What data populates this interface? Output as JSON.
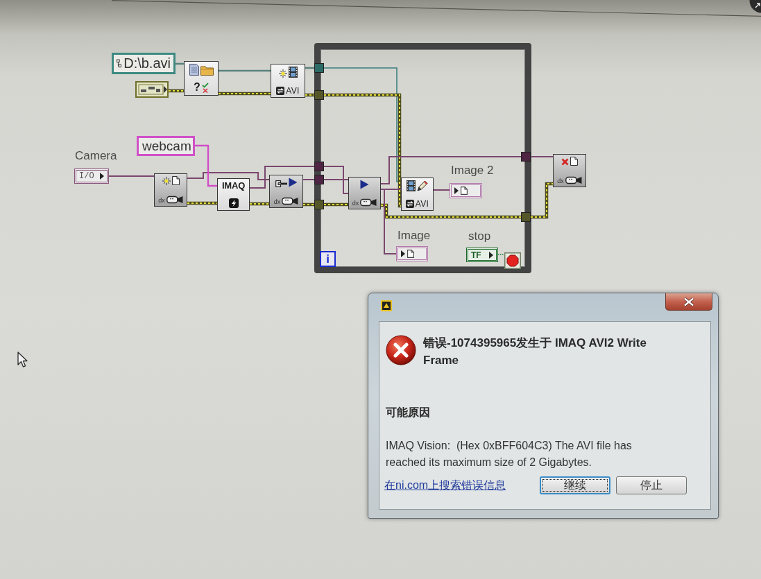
{
  "diagram": {
    "constants": [
      {
        "kind": "path",
        "value": "D:\\b.avi"
      },
      {
        "kind": "string",
        "value": "webcam"
      }
    ],
    "terminals": [
      {
        "kind": "io",
        "label": "Camera",
        "glyph": "I/O"
      },
      {
        "kind": "image",
        "label": "Image 2"
      },
      {
        "kind": "image",
        "label": "Image"
      },
      {
        "kind": "boolean",
        "label": "stop",
        "glyph": "TF"
      }
    ],
    "nodes": [
      {
        "kind": "file-dialog",
        "glyph": "?"
      },
      {
        "kind": "avi-create",
        "glyph": "AVI"
      },
      {
        "kind": "camera-open",
        "glyph": "dx"
      },
      {
        "kind": "imaq-create",
        "glyph": "IMAQ"
      },
      {
        "kind": "camera-config",
        "glyph": "dx"
      },
      {
        "kind": "camera-grab",
        "glyph": "dx"
      },
      {
        "kind": "avi-write",
        "glyph": "AVI"
      },
      {
        "kind": "camera-close",
        "glyph": "dx"
      }
    ],
    "loop": {
      "iteration_glyph": "i"
    }
  },
  "dialog": {
    "heading": "错误-1074395965发生于 IMAQ AVI2 Write Frame",
    "section_title": "可能原因",
    "message": "IMAQ Vision:  (Hex 0xBFF604C3) The AVI file has reached its maximum size of 2 Gigabytes.",
    "link": "在ni.com上搜索错误信息",
    "buttons": [
      {
        "label": "继续",
        "selected": true
      },
      {
        "label": "停止",
        "selected": false
      }
    ]
  }
}
